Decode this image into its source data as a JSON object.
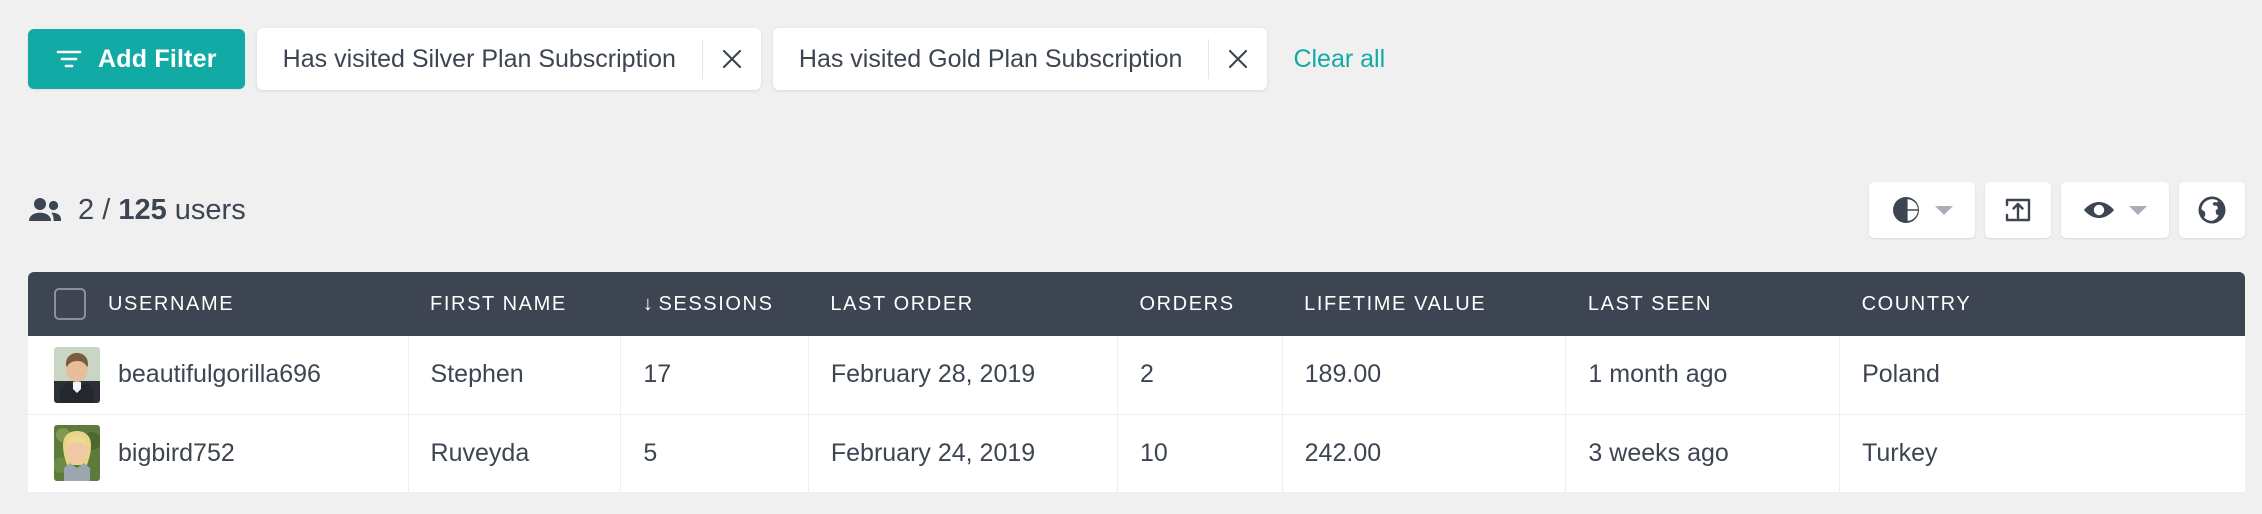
{
  "filter_bar": {
    "add_filter_label": "Add Filter",
    "add_filter_icon": "funnel-icon",
    "accent_color": "#11aaa4",
    "pills": [
      {
        "label": "Has visited Silver Plan Subscription",
        "close_icon": "close-icon"
      },
      {
        "label": "Has visited Gold Plan Subscription",
        "close_icon": "close-icon"
      }
    ],
    "clear_all_label": "Clear all"
  },
  "summary": {
    "icon": "people-icon",
    "selected": "2",
    "separator": "/",
    "total": "125",
    "unit": "users"
  },
  "toolbar": {
    "buttons": [
      {
        "name": "chart-button",
        "icon": "pie-chart-icon",
        "has_caret": true
      },
      {
        "name": "export-button",
        "icon": "export-icon",
        "has_caret": false
      },
      {
        "name": "visibility-button",
        "icon": "eye-icon",
        "has_caret": true
      },
      {
        "name": "globe-button",
        "icon": "globe-icon",
        "has_caret": false
      }
    ]
  },
  "table": {
    "select_all_checkbox": "select-all-checkbox",
    "sort_column": "SESSIONS",
    "sort_direction_glyph": "↓",
    "headers": [
      "USERNAME",
      "FIRST NAME",
      "SESSIONS",
      "LAST ORDER",
      "ORDERS",
      "LIFETIME VALUE",
      "LAST SEEN",
      "COUNTRY"
    ],
    "rows": [
      {
        "username": "beautifulgorilla696",
        "first_name": "Stephen",
        "sessions": "17",
        "last_order": "February 28, 2019",
        "orders": "2",
        "lifetime_value": "189.00",
        "last_seen": "1 month ago",
        "country": "Poland"
      },
      {
        "username": "bigbird752",
        "first_name": "Ruveyda",
        "sessions": "5",
        "last_order": "February 24, 2019",
        "orders": "10",
        "lifetime_value": "242.00",
        "last_seen": "3 weeks ago",
        "country": "Turkey"
      }
    ]
  }
}
